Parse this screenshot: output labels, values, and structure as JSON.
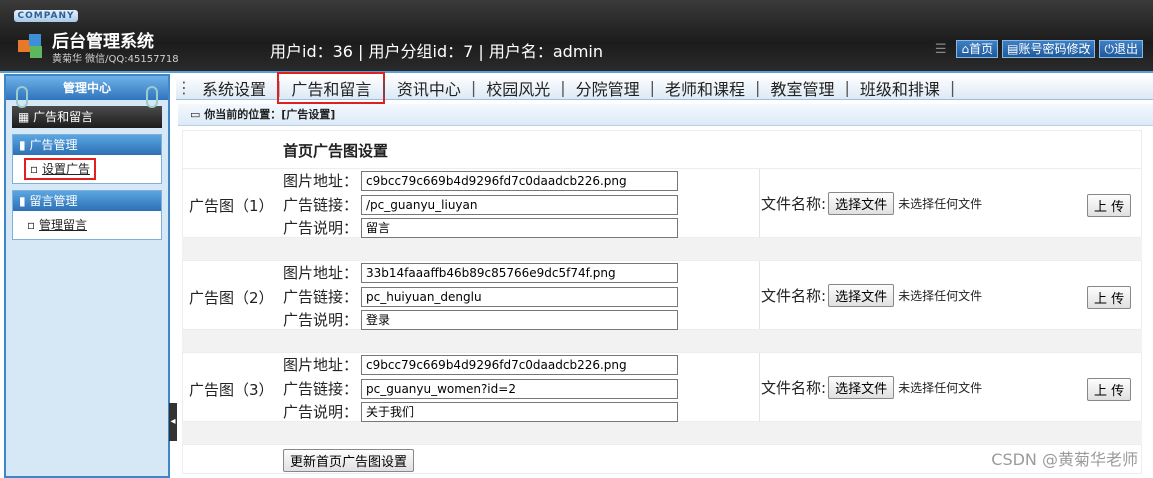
{
  "header": {
    "company": "COMPANY",
    "title": "后台管理系统",
    "subtitle": "黄菊华 微信/QQ:45157718",
    "user_info": "用户id：36 | 用户分组id：7 | 用户名：admin",
    "links": [
      "首页",
      "账号密码修改",
      "退出"
    ]
  },
  "sidebar": {
    "title": "管理中心",
    "selected": "广告和留言",
    "groups": [
      {
        "title": "广告管理",
        "items": [
          "设置广告"
        ]
      },
      {
        "title": "留言管理",
        "items": [
          "管理留言"
        ]
      }
    ]
  },
  "nav": {
    "items": [
      "系统设置",
      "广告和留言",
      "资讯中心",
      "校园风光",
      "分院管理",
      "老师和课程",
      "教室管理",
      "班级和排课"
    ]
  },
  "location": "你当前的位置：[广告设置]",
  "content": {
    "section_title": "首页广告图设置",
    "field_labels": {
      "image": "图片地址：",
      "link": "广告链接：",
      "desc": "广告说明："
    },
    "file_label": "文件名称:",
    "choose_button": "选择文件",
    "no_file": "未选择任何文件",
    "upload_button": "上 传",
    "ads": [
      {
        "label": "广告图（1）",
        "image": "c9bcc79c669b4d9296fd7c0daadcb226.png",
        "link": "/pc_guanyu_liuyan",
        "desc": "留言"
      },
      {
        "label": "广告图（2）",
        "image": "33b14faaaffb46b89c85766e9dc5f74f.png",
        "link": "pc_huiyuan_denglu",
        "desc": "登录"
      },
      {
        "label": "广告图（3）",
        "image": "c9bcc79c669b4d9296fd7c0daadcb226.png",
        "link": "pc_guanyu_women?id=2",
        "desc": "关于我们"
      }
    ],
    "save_button": "更新首页广告图设置"
  },
  "watermark": "CSDN @黄菊华老师"
}
